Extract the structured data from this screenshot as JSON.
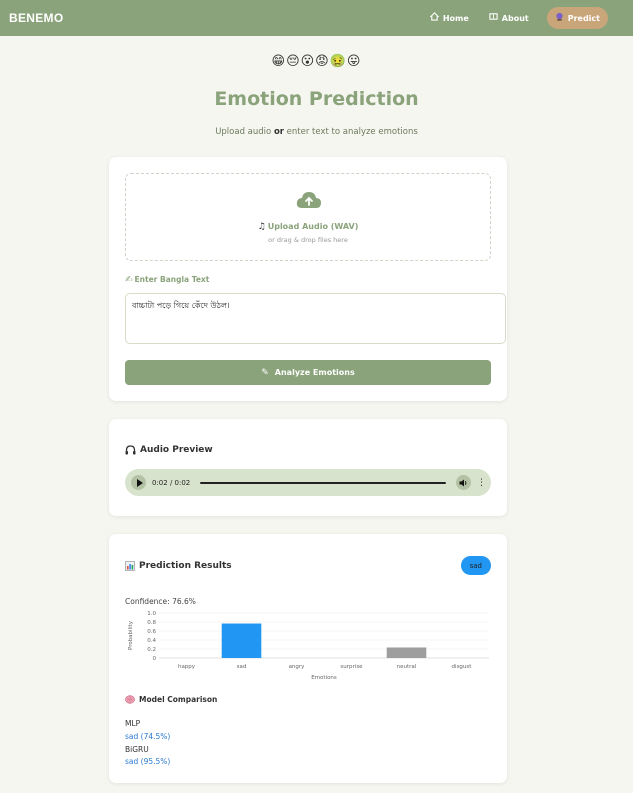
{
  "nav": {
    "brand": "BENEMO",
    "links": [
      {
        "label": "Home",
        "icon": "home-icon"
      },
      {
        "label": "About",
        "icon": "book-icon"
      },
      {
        "label": "Predict",
        "icon": "crystal-ball-icon",
        "active": true
      }
    ]
  },
  "hero": {
    "emojis": "😁😔😮😡🤢😛",
    "title": "Emotion Prediction",
    "subtitle_pre": "Upload audio ",
    "subtitle_bold": "or",
    "subtitle_post": " enter text to analyze emotions"
  },
  "upload": {
    "label": "Upload Audio (WAV)",
    "hint": "or drag & drop files here"
  },
  "text_input": {
    "label": "Enter Bangla Text",
    "value": "বাচ্চাটা পড়ে গিয়ে কেঁদে উঠল।"
  },
  "analyze_button": "Analyze Emotions",
  "audio": {
    "title": "Audio Preview",
    "time": "0:02 / 0:02"
  },
  "results": {
    "title": "Prediction Results",
    "badge": "sad",
    "confidence": "Confidence: 76.6%",
    "model_title": "Model Comparison",
    "models": [
      {
        "name": "MLP",
        "result": "sad (74.5%)"
      },
      {
        "name": "BiGRU",
        "result": "sad (95.5%)"
      }
    ]
  },
  "colors": {
    "primary": "#8aa37b",
    "accent": "#c9a679",
    "highlight": "#2196f3",
    "neutral_bar": "#9e9e9e"
  },
  "chart_data": {
    "type": "bar",
    "categories": [
      "happy",
      "sad",
      "angry",
      "surprise",
      "neutral",
      "disgust"
    ],
    "values": [
      0.0,
      0.766,
      0.0,
      0.0,
      0.234,
      0.0
    ],
    "xlabel": "Emotions",
    "ylabel": "Probability",
    "ylim": [
      0,
      1.0
    ],
    "yticks": [
      0,
      0.2,
      0.4,
      0.6,
      0.8,
      1.0
    ],
    "bar_colors": [
      "#2196f3",
      "#2196f3",
      "#2196f3",
      "#2196f3",
      "#9e9e9e",
      "#2196f3"
    ],
    "grid": true
  }
}
